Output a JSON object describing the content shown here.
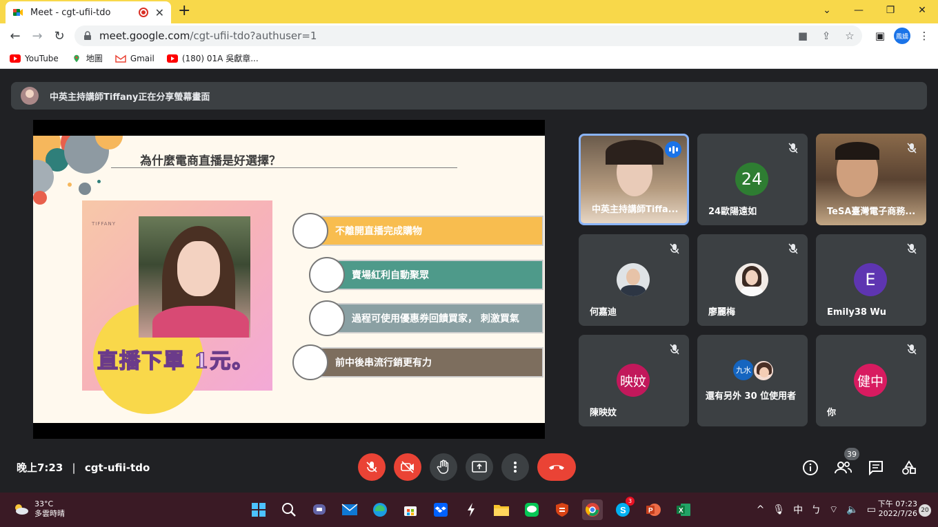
{
  "browser": {
    "tab_title": "Meet - cgt-ufii-tdo",
    "new_tab": "+",
    "url_host": "meet.google.com",
    "url_path": "/cgt-ufii-tdo?authuser=1",
    "profile_label": "鳳嬌",
    "bookmarks": [
      {
        "label": "YouTube"
      },
      {
        "label": "地圖"
      },
      {
        "label": "Gmail"
      },
      {
        "label": "(180) 01A 吳獻章..."
      }
    ]
  },
  "meet": {
    "banner_text": "中英主持講師Tiffany正在分享螢幕畫面",
    "slide": {
      "title": "為什麼電商直播是好選擇？",
      "brand": "TIFFANY",
      "slogan": "直播下單 1元。",
      "items": [
        {
          "label": "不離開直播完成購物",
          "color": "#f8bd4f"
        },
        {
          "label": "賣場紅利自動聚眾",
          "color": "#4e9a8a"
        },
        {
          "label": "過程可使用優惠券回饋買家， 刺激買氣",
          "color": "#8aa0a3"
        },
        {
          "label": "前中後串流行銷更有力",
          "color": "#7d6e5e"
        }
      ]
    },
    "participants": [
      {
        "name": "中英主持講師Tiffa...",
        "type": "video",
        "speaking": true
      },
      {
        "name": "24歐陽遠如",
        "type": "initials",
        "initials": "24",
        "color": "#2e7d32"
      },
      {
        "name": "TeSA臺灣電子商務...",
        "type": "video"
      },
      {
        "name": "何嘉迪",
        "type": "photo"
      },
      {
        "name": "廖麗梅",
        "type": "photo"
      },
      {
        "name": "Emily38 Wu",
        "type": "initials",
        "initials": "E",
        "color": "#5e35b1"
      },
      {
        "name": "陳映妏",
        "type": "initials",
        "initials": "映妏",
        "color": "#c2185b"
      },
      {
        "name": "還有另外 30 位使用者",
        "type": "group",
        "initials": "九水"
      },
      {
        "name": "你",
        "type": "initials",
        "initials": "健中",
        "color": "#d81b60"
      }
    ],
    "time": "晚上7:23",
    "separator": "|",
    "meeting_code": "cgt-ufii-tdo",
    "participant_count": "39"
  },
  "taskbar": {
    "temp": "33°C",
    "weather": "多雲時晴",
    "time": "下午 07:23",
    "date": "2022/7/26",
    "notifications": "20",
    "ime": "中",
    "s_badge": "3"
  }
}
